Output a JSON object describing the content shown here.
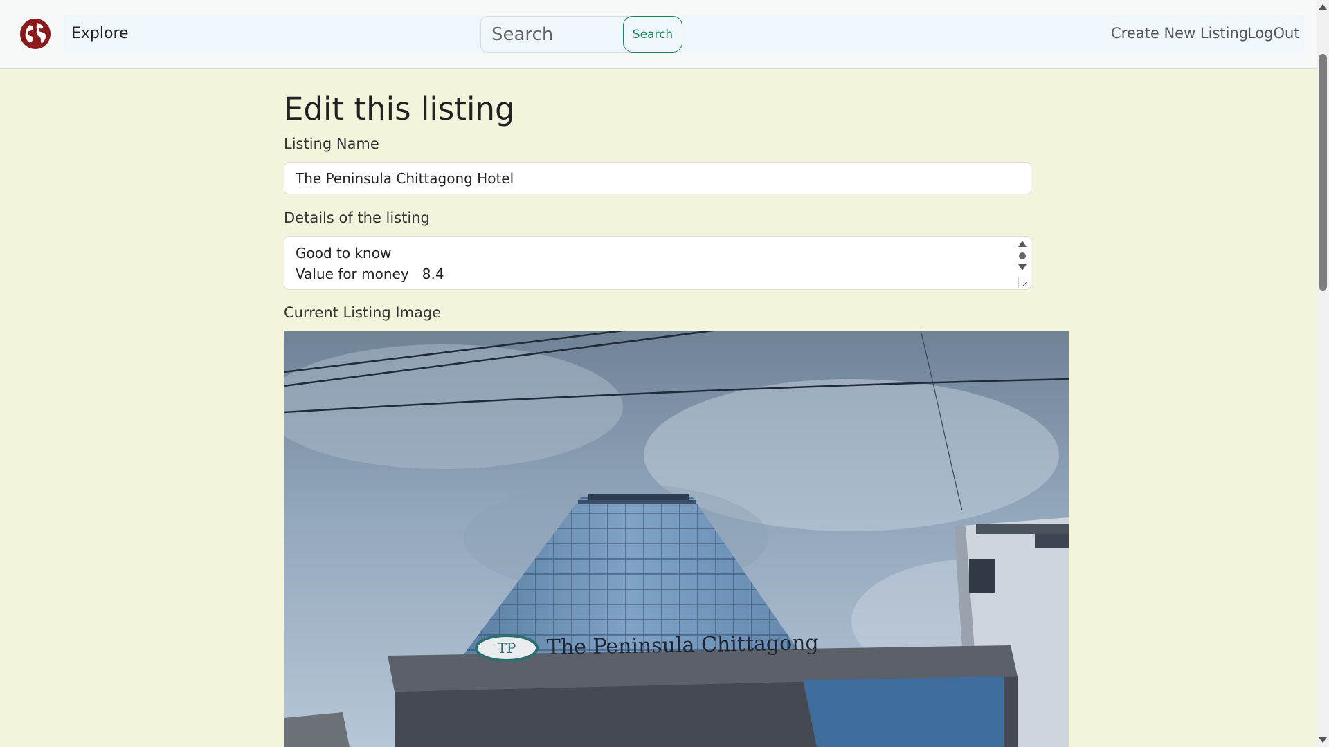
{
  "navbar": {
    "explore_label": "Explore",
    "search_placeholder": "Search",
    "search_button": "Search",
    "create_listing_label": "Create New Listing",
    "logout_label": "LogOut"
  },
  "form": {
    "title": "Edit this listing",
    "name_label": "Listing Name",
    "name_value": "The Peninsula Chittagong Hotel",
    "details_label": "Details of the listing",
    "details_lines": [
      "Good to know",
      "Value for money   8.4"
    ],
    "image_label": "Current Listing Image"
  },
  "image": {
    "signage_text": "The Peninsula Chittagong"
  },
  "colors": {
    "page_background": "#f4f4dc",
    "brand": "#8b1a1a",
    "search_button": "#198754"
  },
  "icons": {
    "logo": "globe-icon"
  }
}
